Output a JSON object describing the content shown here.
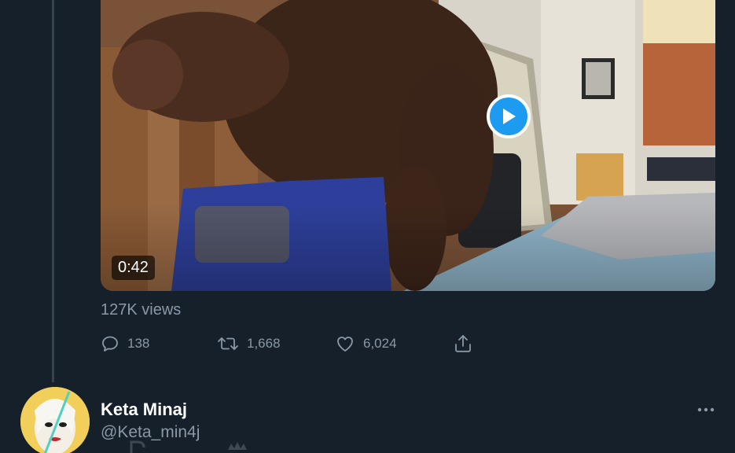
{
  "tweet": {
    "video": {
      "duration": "0:42",
      "play_icon": "play-icon"
    },
    "views": "127K views",
    "actions": {
      "reply": {
        "icon": "reply-icon",
        "count": "138"
      },
      "retweet": {
        "icon": "retweet-icon",
        "count": "1,668"
      },
      "like": {
        "icon": "heart-icon",
        "count": "6,024"
      },
      "share": {
        "icon": "share-icon"
      }
    }
  },
  "next_tweet": {
    "name": "Keta Minaj",
    "handle": "@Keta_min4j",
    "more_icon": "more-icon"
  },
  "colors": {
    "background": "#15202b",
    "accent": "#1d9bf0",
    "secondary_text": "#8b98a5"
  }
}
